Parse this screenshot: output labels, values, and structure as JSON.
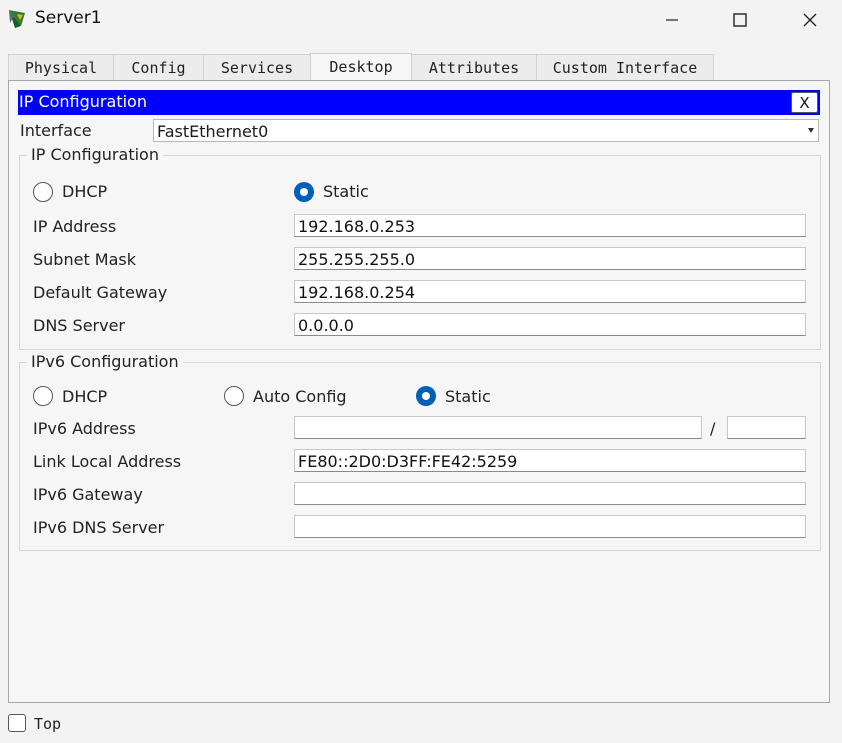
{
  "window": {
    "title": "Server1"
  },
  "tabs": [
    {
      "label": "Physical"
    },
    {
      "label": "Config"
    },
    {
      "label": "Services"
    },
    {
      "label": "Desktop",
      "active": true
    },
    {
      "label": "Attributes"
    },
    {
      "label": "Custom Interface"
    }
  ],
  "app": {
    "header_title": "IP Configuration",
    "close_label": "X",
    "interface_label": "Interface",
    "interface_value": "FastEthernet0"
  },
  "ipv4": {
    "legend": "IP Configuration",
    "dhcp_label": "DHCP",
    "static_label": "Static",
    "mode": "Static",
    "fields": {
      "ip_address": {
        "label": "IP Address",
        "value": "192.168.0.253"
      },
      "subnet_mask": {
        "label": "Subnet Mask",
        "value": "255.255.255.0"
      },
      "default_gateway": {
        "label": "Default Gateway",
        "value": "192.168.0.254"
      },
      "dns_server": {
        "label": "DNS Server",
        "value": "0.0.0.0"
      }
    }
  },
  "ipv6": {
    "legend": "IPv6 Configuration",
    "dhcp_label": "DHCP",
    "auto_label": "Auto Config",
    "static_label": "Static",
    "mode": "Static",
    "prefix_separator": "/",
    "fields": {
      "ipv6_address": {
        "label": "IPv6 Address",
        "value": "",
        "prefix": ""
      },
      "link_local": {
        "label": "Link Local Address",
        "value": "FE80::2D0:D3FF:FE42:5259"
      },
      "ipv6_gateway": {
        "label": "IPv6 Gateway",
        "value": ""
      },
      "ipv6_dns": {
        "label": "IPv6 DNS Server",
        "value": ""
      }
    }
  },
  "footer": {
    "top_label": "Top",
    "top_checked": false
  },
  "colors": {
    "header_bg": "#0000ff",
    "radio_selected": "#005fb8"
  }
}
